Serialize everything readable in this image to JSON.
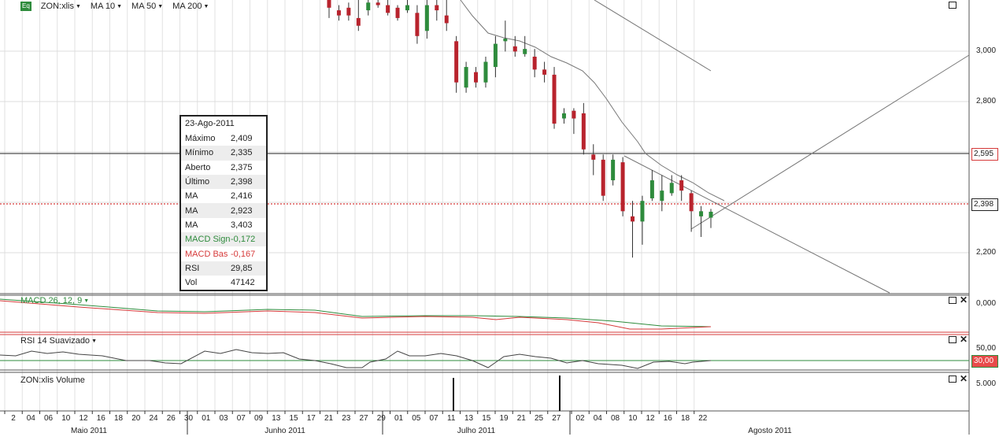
{
  "toolbar": {
    "badge": "Eq",
    "symbol": "ZON:xlis",
    "ma10": "MA 10",
    "ma50": "MA 50",
    "ma200": "MA 200"
  },
  "info": {
    "date": "23-Ago-2011",
    "rows": [
      {
        "label": "Máximo",
        "value": "2,409"
      },
      {
        "label": "Mínimo",
        "value": "2,335"
      },
      {
        "label": "Aberto",
        "value": "2,375"
      },
      {
        "label": "Último",
        "value": "2,398"
      },
      {
        "label": "MA",
        "value": "2,416"
      },
      {
        "label": "MA",
        "value": "2,923"
      },
      {
        "label": "MA",
        "value": "3,403"
      },
      {
        "label": "MACD Sign",
        "value": "-0,172"
      },
      {
        "label": "MACD Bas",
        "value": "-0,167"
      },
      {
        "label": "RSI",
        "value": "29,85"
      },
      {
        "label": "Vol",
        "value": "47142"
      }
    ]
  },
  "price_axis": [
    "3,000",
    "2,800",
    "2,600",
    "2,400",
    "2,200"
  ],
  "price_tags": {
    "resistance": "2,595",
    "last": "2,398"
  },
  "panels": {
    "macd": {
      "label": "MACD 26, 12, 9",
      "axis": "0,000"
    },
    "rsi": {
      "label": "RSI 14 Suavizado",
      "axis": "50,00",
      "tag": "30,00"
    },
    "volume": {
      "label": "ZON:xlis Volume",
      "axis": "5.000"
    }
  },
  "date_ticks": [
    "2",
    "04",
    "06",
    "10",
    "12",
    "16",
    "18",
    "20",
    "24",
    "26",
    "30",
    "01",
    "03",
    "07",
    "09",
    "13",
    "15",
    "17",
    "21",
    "23",
    "27",
    "29",
    "01",
    "05",
    "07",
    "11",
    "13",
    "15",
    "19",
    "21",
    "25",
    "27",
    "02",
    "04",
    "08",
    "10",
    "12",
    "16",
    "18",
    "22"
  ],
  "months": [
    "Maio 2011",
    "Junho 2011",
    "Julho 2011",
    "Agosto 2011"
  ],
  "colors": {
    "green": "#2e8b3c",
    "red": "#d63a3a",
    "up": "#2e8b3c",
    "down": "#b8232d"
  },
  "chart_data": {
    "type": "candlestick",
    "ylim": [
      2.08,
      3.22
    ],
    "candles": [
      {
        "d": "23",
        "o": 3.22,
        "h": 3.22,
        "l": 3.15,
        "c": 3.19
      },
      {
        "d": "27",
        "o": 3.18,
        "h": 3.2,
        "l": 3.14,
        "c": 3.16
      },
      {
        "d": "27b",
        "o": 3.19,
        "h": 3.21,
        "l": 3.14,
        "c": 3.16
      },
      {
        "d": "29",
        "o": 3.15,
        "h": 3.22,
        "l": 3.1,
        "c": 3.12
      },
      {
        "d": "30",
        "o": 3.18,
        "h": 3.22,
        "l": 3.16,
        "c": 3.21
      },
      {
        "d": "01",
        "o": 3.21,
        "h": 3.22,
        "l": 3.19,
        "c": 3.2
      },
      {
        "d": "05",
        "o": 3.2,
        "h": 3.22,
        "l": 3.16,
        "c": 3.17
      },
      {
        "d": "07",
        "o": 3.19,
        "h": 3.2,
        "l": 3.14,
        "c": 3.15
      },
      {
        "d": "07b",
        "o": 3.18,
        "h": 3.22,
        "l": 3.17,
        "c": 3.2
      },
      {
        "d": "11",
        "o": 3.17,
        "h": 3.2,
        "l": 3.05,
        "c": 3.08
      },
      {
        "d": "11b",
        "o": 3.1,
        "h": 3.22,
        "l": 3.07,
        "c": 3.2
      },
      {
        "d": "13",
        "o": 3.2,
        "h": 3.22,
        "l": 3.14,
        "c": 3.18
      },
      {
        "d": "13b",
        "o": 3.16,
        "h": 3.22,
        "l": 3.1,
        "c": 3.13
      },
      {
        "d": "15",
        "o": 3.06,
        "h": 3.08,
        "l": 2.86,
        "c": 2.9
      },
      {
        "d": "19",
        "o": 2.88,
        "h": 2.98,
        "l": 2.86,
        "c": 2.96
      },
      {
        "d": "19b",
        "o": 2.94,
        "h": 2.96,
        "l": 2.88,
        "c": 2.9
      },
      {
        "d": "21",
        "o": 2.9,
        "h": 3.0,
        "l": 2.88,
        "c": 2.98
      },
      {
        "d": "21b",
        "o": 2.96,
        "h": 3.08,
        "l": 2.92,
        "c": 3.05
      },
      {
        "d": "25",
        "o": 3.06,
        "h": 3.14,
        "l": 3.02,
        "c": 3.07
      },
      {
        "d": "25b",
        "o": 3.04,
        "h": 3.08,
        "l": 3.0,
        "c": 3.02
      },
      {
        "d": "27",
        "o": 3.01,
        "h": 3.08,
        "l": 3.0,
        "c": 3.03
      },
      {
        "d": "27b",
        "o": 3.0,
        "h": 3.03,
        "l": 2.92,
        "c": 2.95
      },
      {
        "d": "02",
        "o": 2.95,
        "h": 2.98,
        "l": 2.9,
        "c": 2.93
      },
      {
        "d": "02b",
        "o": 2.93,
        "h": 2.96,
        "l": 2.72,
        "c": 2.74
      },
      {
        "d": "04",
        "o": 2.76,
        "h": 2.8,
        "l": 2.74,
        "c": 2.78
      },
      {
        "d": "04b",
        "o": 2.79,
        "h": 2.8,
        "l": 2.7,
        "c": 2.76
      },
      {
        "d": "08",
        "o": 2.78,
        "h": 2.82,
        "l": 2.62,
        "c": 2.64
      },
      {
        "d": "08b",
        "o": 2.62,
        "h": 2.66,
        "l": 2.54,
        "c": 2.6
      },
      {
        "d": "10",
        "o": 2.6,
        "h": 2.62,
        "l": 2.44,
        "c": 2.46
      },
      {
        "d": "10b",
        "o": 2.52,
        "h": 2.62,
        "l": 2.5,
        "c": 2.6
      },
      {
        "d": "12",
        "o": 2.59,
        "h": 2.61,
        "l": 2.38,
        "c": 2.4
      },
      {
        "d": "12b",
        "o": 2.38,
        "h": 2.44,
        "l": 2.22,
        "c": 2.36
      },
      {
        "d": "16",
        "o": 2.36,
        "h": 2.46,
        "l": 2.27,
        "c": 2.44
      },
      {
        "d": "16b",
        "o": 2.45,
        "h": 2.56,
        "l": 2.44,
        "c": 2.52
      },
      {
        "d": "18",
        "o": 2.44,
        "h": 2.54,
        "l": 2.4,
        "c": 2.48
      },
      {
        "d": "18b",
        "o": 2.47,
        "h": 2.54,
        "l": 2.46,
        "c": 2.51
      },
      {
        "d": "22",
        "o": 2.52,
        "h": 2.54,
        "l": 2.44,
        "c": 2.48
      },
      {
        "d": "22b",
        "o": 2.47,
        "h": 2.48,
        "l": 2.32,
        "c": 2.4
      },
      {
        "d": "22c",
        "o": 2.38,
        "h": 2.42,
        "l": 2.3,
        "c": 2.4
      },
      {
        "d": "23",
        "o": 2.375,
        "h": 2.409,
        "l": 2.335,
        "c": 2.398
      }
    ]
  }
}
